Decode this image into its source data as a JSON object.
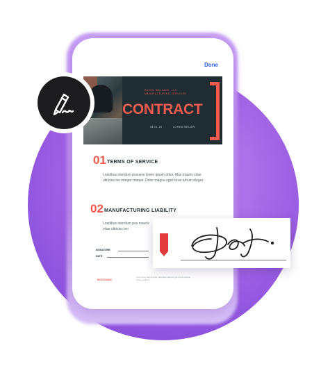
{
  "header": {
    "done_label": "Done"
  },
  "banner": {
    "kicker_line1": "RAVEN WALLACE, LLC",
    "kicker_line2": "MANUFACTURING SERVICES",
    "title": "CONTRACT",
    "date": "08.01.20",
    "author": "LOREM BELOW"
  },
  "sections": [
    {
      "number": "01",
      "title": "TERMS OF SERVICE",
      "body": "Losdibus interdum posuere lorem ipsum dolor. Mus mauris vitae ultricies leo integer maque. Dolor magna eget lunar arhum eleger."
    },
    {
      "number": "02",
      "title": "MANUFACTURING LIABILITY",
      "body": "Losdibus interdum pos mauris vitae ultricies leo"
    }
  ],
  "signature_fields": {
    "signature_label": "SIGNATURE:",
    "date_label": "DATE:"
  },
  "footer": {
    "logo_text": "BOOSANIC",
    "fine_print": "Lorem ipsum dolor sit amet consectetur adipiscing elit sed do eiusmod tempor incididunt"
  },
  "colors": {
    "accent": "#f25a4d",
    "banner_bg": "#1f2d33",
    "purple": "#a366e6",
    "done_blue": "#2f5fe0"
  },
  "icons": {
    "badge": "signature-pen-icon",
    "flag": "bookmark-flag-icon"
  }
}
